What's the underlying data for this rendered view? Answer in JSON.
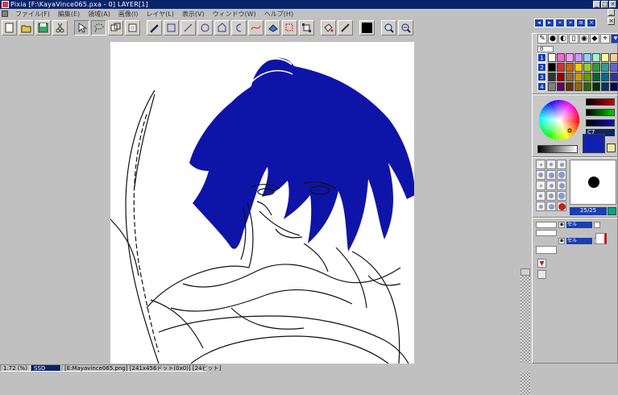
{
  "app": {
    "title": "Pixia    [F:\\KayaVince065.pxa - 0] LAYER[1]"
  },
  "menu": {
    "items": [
      "ファイル(F)",
      "編集(E)",
      "領域(A)",
      "画像(I)",
      "レイヤ(L)",
      "表示(V)",
      "ウィンドウ(W)",
      "ヘルプ(H)"
    ]
  },
  "toolbar": {
    "buttons": [
      {
        "name": "new-file-icon"
      },
      {
        "name": "open-folder-icon"
      },
      {
        "name": "save-icon"
      },
      {
        "name": "cut-icon"
      },
      {
        "name": "pointer-tool-icon"
      },
      {
        "name": "lasso-tool-icon"
      },
      {
        "name": "move-tool-icon"
      },
      {
        "name": "layer-move-icon"
      },
      {
        "name": "pen-tool-icon"
      },
      {
        "name": "rectangle-tool-icon"
      },
      {
        "name": "line-tool-icon"
      },
      {
        "name": "ellipse-tool-icon"
      },
      {
        "name": "polygon-tool-icon"
      },
      {
        "name": "curve-tool-icon"
      },
      {
        "name": "bezier-tool-icon"
      },
      {
        "name": "fill-tool-icon"
      },
      {
        "name": "select-rect-icon"
      },
      {
        "name": "transform-icon"
      },
      {
        "name": "bucket-icon"
      },
      {
        "name": "brush-icon"
      },
      {
        "name": "color-swatch-icon"
      },
      {
        "name": "zoom-in-icon"
      },
      {
        "name": "zoom-out-icon"
      }
    ]
  },
  "canvas": {
    "hair_color": "#0f14a8",
    "line_color": "#111111"
  },
  "palette": {
    "page_labels": [
      "1",
      "2",
      "3",
      "4"
    ],
    "value_field": "0",
    "colors": [
      [
        "#ffffff",
        "#ff66cc",
        "#ff99ff",
        "#cc99ff",
        "#99ccff",
        "#99ffcc",
        "#ffff99",
        "#ffcc99"
      ],
      [
        "#000000",
        "#cc3333",
        "#cc6600",
        "#ffcc00",
        "#99cc33",
        "#339933",
        "#339999",
        "#6666cc"
      ],
      [
        "#333333",
        "#990000",
        "#996633",
        "#cc9900",
        "#669900",
        "#006633",
        "#006699",
        "#333399"
      ],
      [
        "#808080",
        "#660066",
        "#663300",
        "#996600",
        "#336600",
        "#003300",
        "#003366",
        "#000066"
      ]
    ]
  },
  "color_picker": {
    "bar_red": "#cc0000",
    "bar_green": "#00aa00",
    "bar_blue": "#1010c0",
    "value_label": "C7",
    "current_color": "#1020b0"
  },
  "brush": {
    "size_label": "25/25"
  },
  "layers": {
    "items": [
      {
        "label": "セル"
      },
      {
        "label": "セル"
      }
    ]
  },
  "status": {
    "zoom": "1.72 (%)",
    "mode": "SSD",
    "info": "[E:Mayavince065.png] [241x456ドット(0x0)] [24ビット]"
  }
}
